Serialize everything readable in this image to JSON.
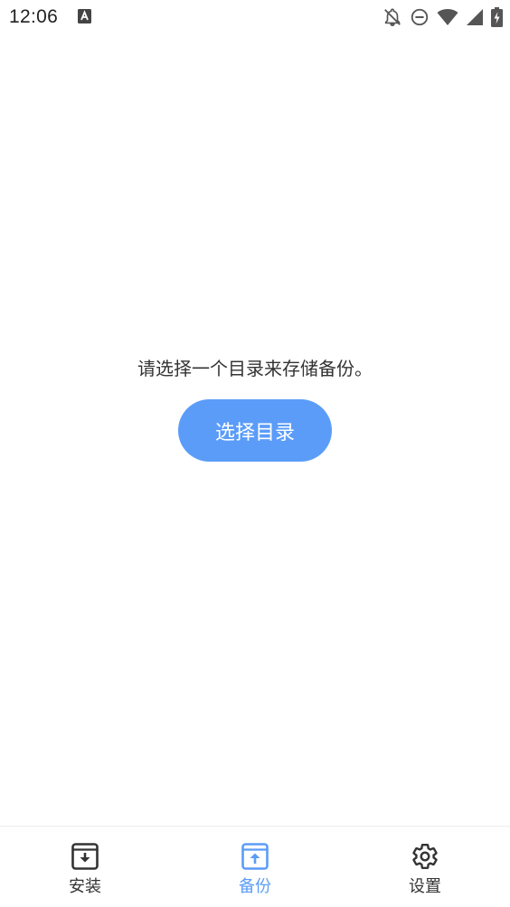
{
  "status_bar": {
    "time": "12:06",
    "icons": [
      "app-notification-icon",
      "notifications-off-icon",
      "do-not-disturb-icon",
      "wifi-icon",
      "cell-signal-icon",
      "battery-charging-icon"
    ]
  },
  "main": {
    "message": "请选择一个目录来存储备份。",
    "button_label": "选择目录"
  },
  "bottom_nav": {
    "items": [
      {
        "label": "安装",
        "icon": "install-box-icon",
        "active": false
      },
      {
        "label": "备份",
        "icon": "backup-box-icon",
        "active": true
      },
      {
        "label": "设置",
        "icon": "gear-icon",
        "active": false
      }
    ]
  },
  "colors": {
    "accent": "#5b9cf8",
    "text": "#333333",
    "background": "#ffffff"
  }
}
